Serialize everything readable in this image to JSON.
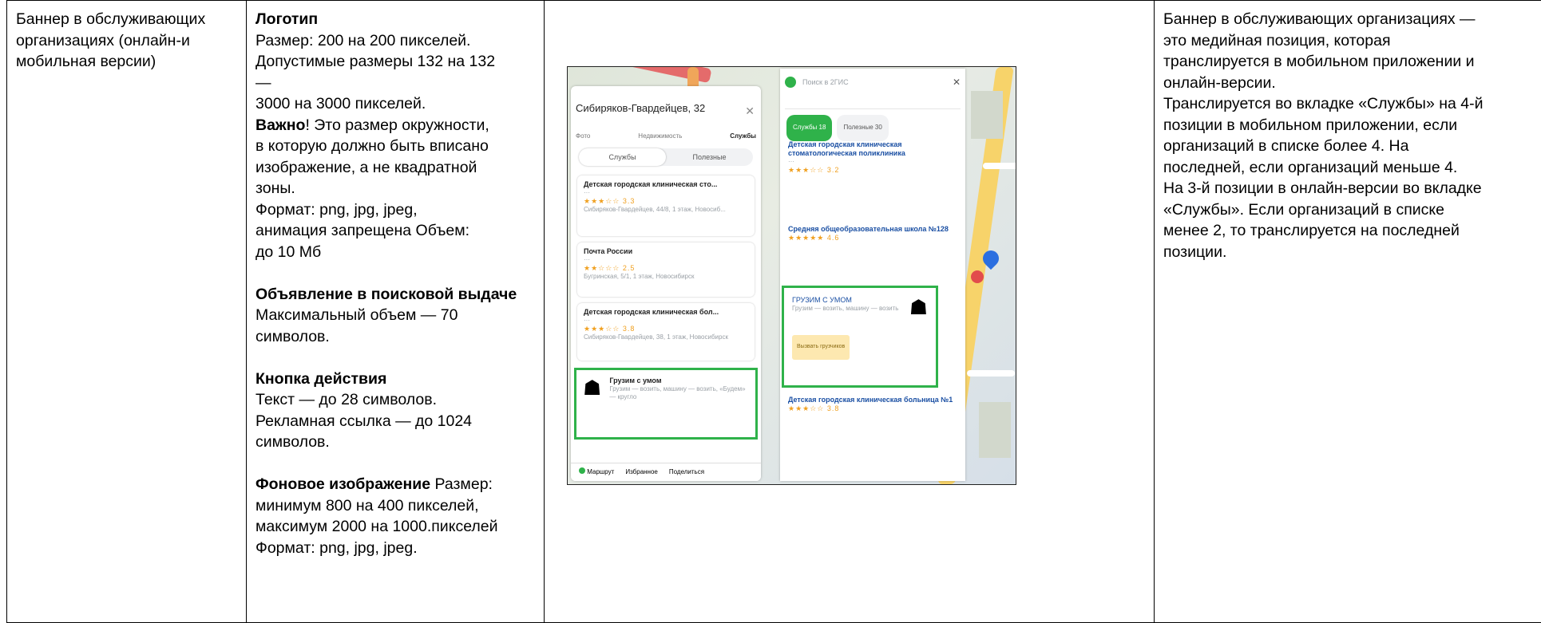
{
  "col1": {
    "lines": [
      "Баннер в обслуживающих",
      "организациях (онлайн-и",
      "мобильная версии)"
    ]
  },
  "col2": {
    "logo_heading": "Логотип",
    "logo_lines": [
      "Размер: 200 на 200 пикселей.",
      "Допустимые размеры 132 на 132",
      "—",
      "3000 на 3000 пикселей."
    ],
    "important_label": "Важно",
    "important_rest": "! Это размер окружности,",
    "important_lines": [
      "в которую должно быть вписано",
      "изображение, а не квадратной",
      "зоны.",
      "Формат: png, jpg, jpeg,",
      "анимация запрещена Объем:",
      "до 10 Мб"
    ],
    "ad_heading": "Объявление в поисковой выдаче",
    "ad_lines": [
      "Максимальный объем — 70",
      "символов."
    ],
    "button_heading": "Кнопка действия",
    "button_lines": [
      "Текст — до 28 символов.",
      "Рекламная ссылка — до 1024",
      "символов."
    ],
    "bg_heading": "Фоновое изображение",
    "bg_heading_rest": " Размер:",
    "bg_lines": [
      "минимум 800 на 400 пикселей,",
      "максимум 2000 на 1000.пикселей",
      "Формат: png, jpg, jpeg."
    ]
  },
  "col4": {
    "lines": [
      "Баннер в обслуживающих организациях —",
      "это медийная позиция, которая",
      "транслируется в мобильном приложении и",
      "онлайн-версии.",
      "Транслируется во вкладке «Службы» на 4-й",
      "позиции в мобильном приложении, если",
      "организаций в списке более 4. На",
      "последней, если организаций меньше 4.",
      "На 3-й позиции в онлайн-версии во вкладке",
      "«Службы». Если организаций в списке",
      "менее 2, то транслируется на последней",
      "позиции."
    ]
  },
  "screenshot": {
    "left_panel": {
      "address": "Сибиряков-Гвардейцев, 32",
      "tabs": [
        "Фото",
        "Недвижимость",
        "Службы"
      ],
      "segments": [
        "Службы",
        "Полезные"
      ],
      "cards": [
        {
          "title": "Детская городская клиническая сто...",
          "rating": "3.3",
          "address": "Сибиряков-Гвардейцев, 44/8, 1 этаж, Новосиб..."
        },
        {
          "title": "Почта России",
          "rating": "2.5",
          "address": "Бугринская, 5/1, 1 этаж, Новосибирск"
        },
        {
          "title": "Детская городская клиническая бол...",
          "rating": "3.8",
          "address": "Сибиряков-Гвардейцев, 38, 1 этаж, Новосибирск"
        }
      ],
      "ad": {
        "title": "Грузим с умом",
        "text": "Грузим — возить, машину — возить, «Будем» — кругло"
      },
      "bottom": [
        "Маршрут",
        "Избранное",
        "Поделиться"
      ]
    },
    "right_panel": {
      "search": "Поиск в 2ГИС",
      "chips": [
        "Службы 18",
        "Полезные 30"
      ],
      "cards": [
        {
          "title": "Детская городская клиническая стоматологическая поликлиника",
          "rating": "3.2"
        },
        {
          "title": "Средняя общеобразовательная школа №128",
          "rating": "4.6"
        },
        {
          "title": "Детская городская клиническая больница №1",
          "rating": "3.8"
        }
      ],
      "ad": {
        "title": "ГРУЗИМ С УМОМ",
        "text": "Грузим — возить, машину — возить",
        "button": "Вызвать грузчиков"
      }
    }
  }
}
